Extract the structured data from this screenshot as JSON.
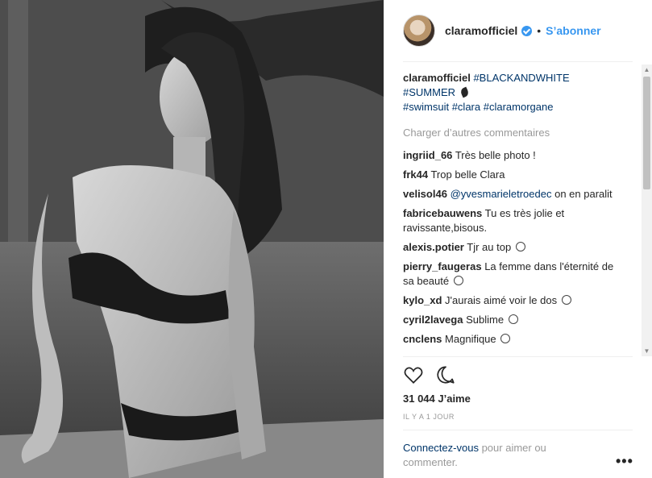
{
  "post": {
    "username": "claramofficiel",
    "follow_label": "S’abonner",
    "separator": "•",
    "caption": {
      "username": "claramofficiel",
      "tag1": "#BLACKANDWHITE",
      "tag2": "#SUMMER",
      "tag3": "#swimsuit",
      "tag4": "#clara",
      "tag5": "#claramorgane"
    },
    "load_more": "Charger d’autres commentaires",
    "comments": [
      {
        "user": "ingriid_66",
        "text": "Très belle photo !"
      },
      {
        "user": "frk44",
        "text": "Trop belle Clara"
      },
      {
        "user": "velisol46",
        "mention": "@yvesmarieletroedec",
        "text": "on en paralit"
      },
      {
        "user": "fabricebauwens",
        "text": "Tu es très jolie et ravissante,bisous."
      },
      {
        "user": "alexis.potier",
        "text": "Tjr au top"
      },
      {
        "user": "pierry_faugeras",
        "text": "La femme dans l'éternité de sa beauté"
      },
      {
        "user": "kylo_xd",
        "text": "J'aurais aimé voir le dos"
      },
      {
        "user": "cyril2lavega",
        "text": "Sublime"
      },
      {
        "user": "cnclens",
        "text": "Magnifique"
      }
    ],
    "likes": "31 044 J’aime",
    "time": "IL Y A 1 JOUR",
    "login_link": "Connectez-vous",
    "login_text": "pour aimer ou commenter.",
    "more_label": "•••"
  },
  "icons": {
    "heart": "heart-icon",
    "comment": "comment-icon",
    "verified": "verified-badge-icon"
  },
  "colors": {
    "link": "#3897f0",
    "tag": "#003569",
    "muted": "#999999"
  }
}
